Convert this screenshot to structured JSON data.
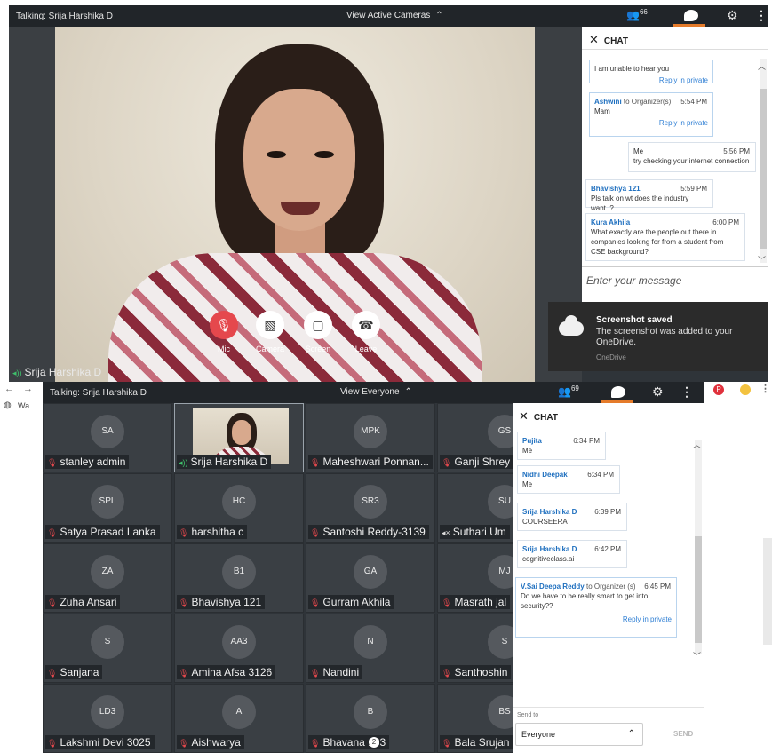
{
  "top_window": {
    "talking": "Talking: Srija Harshika D",
    "view_mode": "View Active Cameras",
    "participant_count": "66",
    "controls": {
      "mic": "Mic",
      "camera": "Camera",
      "screen": "Screen",
      "leave": "Leave"
    },
    "speaker_name": "Srija Harshika D",
    "chat": {
      "title": "CHAT",
      "messages": [
        {
          "text": "I am unable to hear you",
          "reply": "Reply in private"
        },
        {
          "sender": "Ashwini",
          "to": "to Organizer(s)",
          "time": "5:54 PM",
          "text": "Mam",
          "reply": "Reply in private"
        },
        {
          "sender": "Me",
          "time": "5:56 PM",
          "text": "try checking your internet connection"
        },
        {
          "sender": "Bhavishya 121",
          "time": "5:59 PM",
          "text": "Pls talk on wt does the industry want..?"
        },
        {
          "sender": "Kura Akhila",
          "time": "6:00 PM",
          "text": "What exactly are the people out there in companies looking for from a student from CSE background?"
        }
      ],
      "input_placeholder": "Enter your message"
    },
    "toast": {
      "title": "Screenshot saved",
      "body": "The screenshot was added to your OneDrive.",
      "source": "OneDrive"
    }
  },
  "browser": {
    "tab_fragment": "Wa"
  },
  "bottom_window": {
    "talking": "Talking: Srija Harshika D",
    "view_mode": "View Everyone",
    "participant_count": "69",
    "tiles": [
      {
        "initials": "SA",
        "name": "stanley admin"
      },
      {
        "initials": "",
        "name": "Srija Harshika D"
      },
      {
        "initials": "MPK",
        "name": "Maheshwari Ponnan..."
      },
      {
        "initials": "GS",
        "name": "Ganji Shrey"
      },
      {
        "initials": "SPL",
        "name": "Satya Prasad Lanka"
      },
      {
        "initials": "HC",
        "name": "harshitha c"
      },
      {
        "initials": "SR3",
        "name": "Santoshi Reddy-3139"
      },
      {
        "initials": "SU",
        "name": "Suthari Um"
      },
      {
        "initials": "ZA",
        "name": "Zuha Ansari"
      },
      {
        "initials": "B1",
        "name": "Bhavishya 121"
      },
      {
        "initials": "GA",
        "name": "Gurram Akhila"
      },
      {
        "initials": "MJ",
        "name": "Masrath jal"
      },
      {
        "initials": "S",
        "name": "Sanjana"
      },
      {
        "initials": "AA3",
        "name": "Amina Afsa 3126"
      },
      {
        "initials": "N",
        "name": "Nandini"
      },
      {
        "initials": "S",
        "name": "Santhoshin"
      },
      {
        "initials": "LD3",
        "name": "Lakshmi Devi 3025"
      },
      {
        "initials": "A",
        "name": "Aishwarya"
      },
      {
        "initials": "B",
        "name": "Bhavana 133"
      },
      {
        "initials": "BS",
        "name": "Bala Srujan"
      }
    ],
    "chat": {
      "title": "CHAT",
      "messages": [
        {
          "sender": "Pujita",
          "time": "6:34 PM",
          "text": "Me"
        },
        {
          "sender": "Nidhi Deepak",
          "time": "6:34 PM",
          "text": "Me"
        },
        {
          "sender": "Srija Harshika D",
          "time": "6:39 PM",
          "text": "COURSEERA"
        },
        {
          "sender": "Srija Harshika D",
          "time": "6:42 PM",
          "text": "cognitiveclass.ai"
        },
        {
          "sender": "V.Sai Deepa Reddy",
          "to": "to Organizer (s)",
          "time": "6:45 PM",
          "text": "Do we have to be really smart to get into security??",
          "reply": "Reply in private"
        }
      ],
      "send_to_label": "Send to",
      "send_to_value": "Everyone",
      "send_button": "SEND"
    },
    "badge": "2"
  }
}
